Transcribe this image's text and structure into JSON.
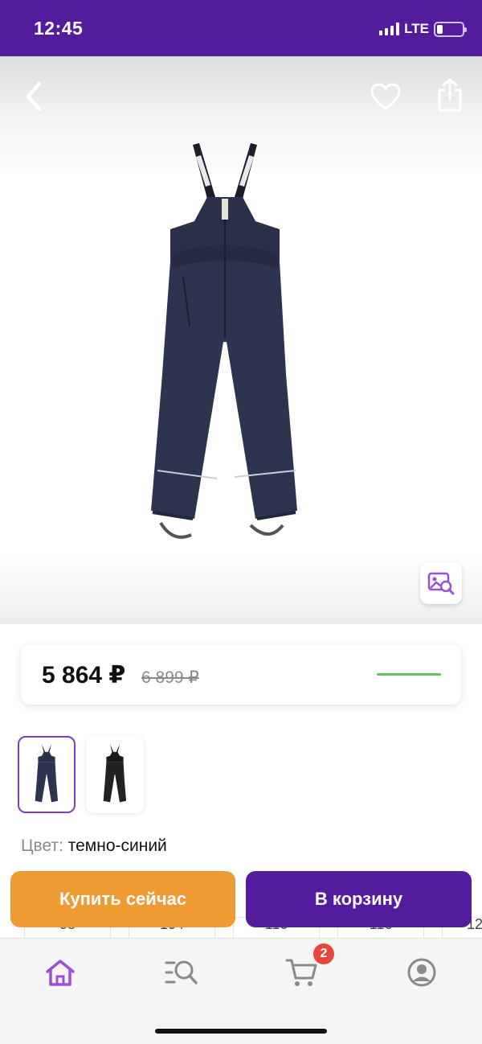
{
  "status": {
    "time": "12:45",
    "network": "LTE",
    "battery_level": 0.22
  },
  "product": {
    "icons": {
      "back": "chevron-left-icon",
      "favorite": "heart-icon",
      "share": "share-icon",
      "visual_search": "image-search-icon"
    },
    "price_current": "5 864 ₽",
    "price_old": "6 899 ₽",
    "accent_color": "#63c466",
    "thumbnails": [
      {
        "name": "navy-variant",
        "selected": true
      },
      {
        "name": "black-variant",
        "selected": false
      }
    ],
    "color_label": "Цвет:",
    "color_value": "темно-синий",
    "sizes": [
      "98",
      "104",
      "110",
      "116",
      "12"
    ]
  },
  "actions": {
    "buy_now": "Купить сейчас",
    "add_to_cart": "В корзину",
    "buy_color": "#ef9b34",
    "cart_color": "#521c9c"
  },
  "tabbar": {
    "items": [
      {
        "name": "home",
        "icon": "home-icon",
        "active": true
      },
      {
        "name": "catalog",
        "icon": "catalog-search-icon",
        "active": false
      },
      {
        "name": "cart",
        "icon": "cart-icon",
        "active": false
      },
      {
        "name": "profile",
        "icon": "profile-icon",
        "active": false
      }
    ],
    "cart_count": "2",
    "active_color": "#9b4fd6"
  }
}
